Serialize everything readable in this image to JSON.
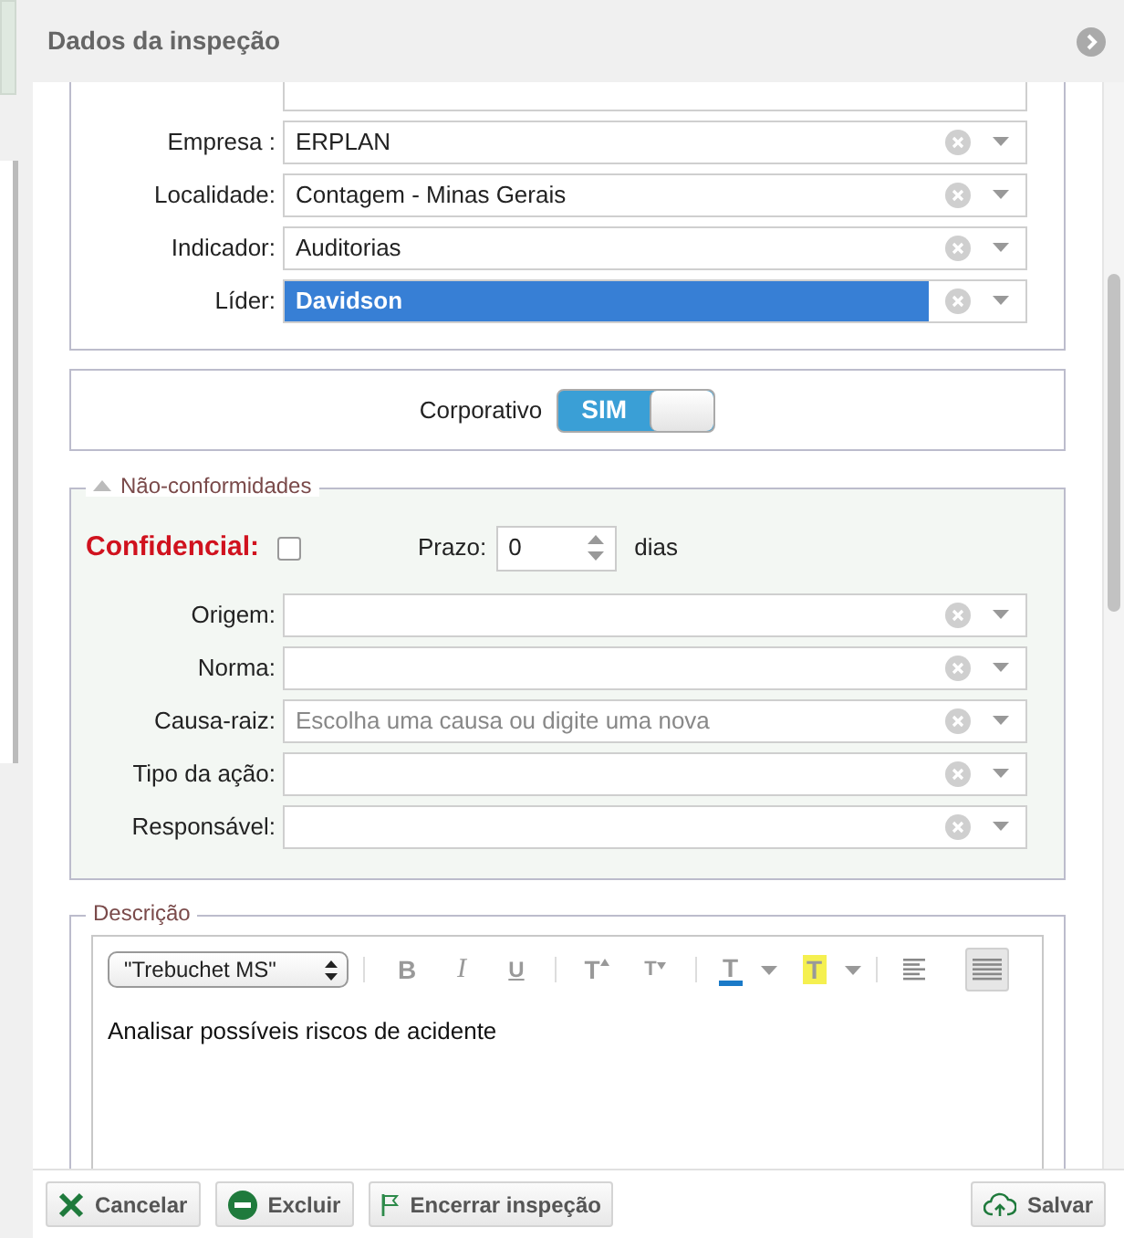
{
  "header": {
    "title": "Dados da inspeção"
  },
  "main_fields": [
    {
      "label": "Empresa :",
      "value": "ERPLAN",
      "selected": false
    },
    {
      "label": "Localidade:",
      "value": "Contagem - Minas Gerais",
      "selected": false
    },
    {
      "label": "Indicador:",
      "value": "Auditorias",
      "selected": false
    },
    {
      "label": "Líder:",
      "value": "Davidson",
      "selected": true
    }
  ],
  "corporativo": {
    "label": "Corporativo",
    "toggle_text": "SIM",
    "on": true
  },
  "nao_conformidades": {
    "legend": "Não-conformidades",
    "expanded": true,
    "confidencial": {
      "label": "Confidencial:",
      "checked": false
    },
    "prazo": {
      "label": "Prazo:",
      "value": "0",
      "unit": "dias"
    },
    "fields": [
      {
        "label": "Origem:"
      },
      {
        "label": "Norma:"
      },
      {
        "label": "Causa-raiz:",
        "placeholder": "Escolha uma causa ou digite uma nova"
      },
      {
        "label": "Tipo da ação:"
      },
      {
        "label": "Responsável:"
      }
    ]
  },
  "descricao": {
    "legend": "Descrição",
    "font": "\"Trebuchet MS\"",
    "text": "Analisar possíveis riscos de acidente",
    "format_buttons": [
      {
        "kind": "bold",
        "glyph": "B"
      },
      {
        "kind": "italic",
        "glyph": "I"
      },
      {
        "kind": "underline",
        "glyph": "U"
      },
      {
        "kind": "grow",
        "glyph": "T"
      },
      {
        "kind": "shrink",
        "glyph": "T"
      },
      {
        "kind": "color",
        "glyph": "T"
      },
      {
        "kind": "highlight",
        "glyph": "T"
      }
    ],
    "alignments": [
      {
        "kind": "left",
        "selected": false
      },
      {
        "kind": "justify",
        "selected": true
      }
    ]
  },
  "buttons": [
    {
      "kind": "cancel",
      "label": "Cancelar"
    },
    {
      "kind": "delete",
      "label": "Excluir"
    },
    {
      "kind": "close",
      "label": "Encerrar inspeção"
    },
    {
      "kind": "save",
      "label": "Salvar"
    }
  ]
}
